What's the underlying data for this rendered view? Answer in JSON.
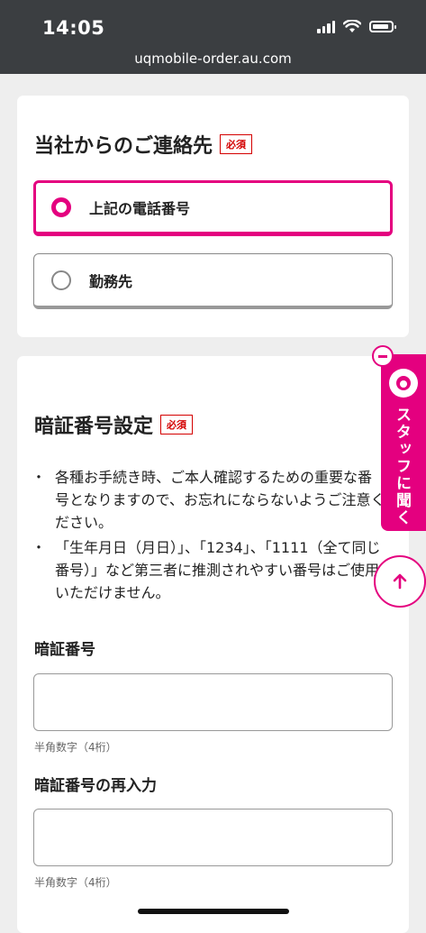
{
  "status_bar": {
    "time": "14:05"
  },
  "browser": {
    "url": "uqmobile-order.au.com"
  },
  "contact_section": {
    "title": "当社からのご連絡先",
    "required_badge": "必須",
    "options": [
      {
        "label": "上記の電話番号",
        "selected": true
      },
      {
        "label": "勤務先",
        "selected": false
      }
    ]
  },
  "pin_section": {
    "title": "暗証番号設定",
    "required_badge": "必須",
    "notes": [
      "各種お手続き時、ご本人確認するための重要な番号となりますので、お忘れにならないようご注意ください。",
      "「生年月日（月日）」、「1234」、「1111（全て同じ番号）」など第三者に推測されやすい番号はご使用いただけません。"
    ],
    "pin_label": "暗証番号",
    "pin_value": "",
    "pin_hint": "半角数字（4桁）",
    "pin_confirm_label": "暗証番号の再入力",
    "pin_confirm_value": "",
    "pin_confirm_hint": "半角数字（4桁）"
  },
  "staff_widget": {
    "label": "スタッフに聞く"
  },
  "icons": {
    "signal": "signal-icon",
    "wifi": "wifi-icon",
    "battery": "battery-icon",
    "collapse": "minus-icon",
    "scroll_top": "arrow-up-icon",
    "staff": "staff-headset-icon"
  },
  "colors": {
    "accent": "#e4007f",
    "required": "#d40000",
    "topbar": "#3b3e41"
  }
}
